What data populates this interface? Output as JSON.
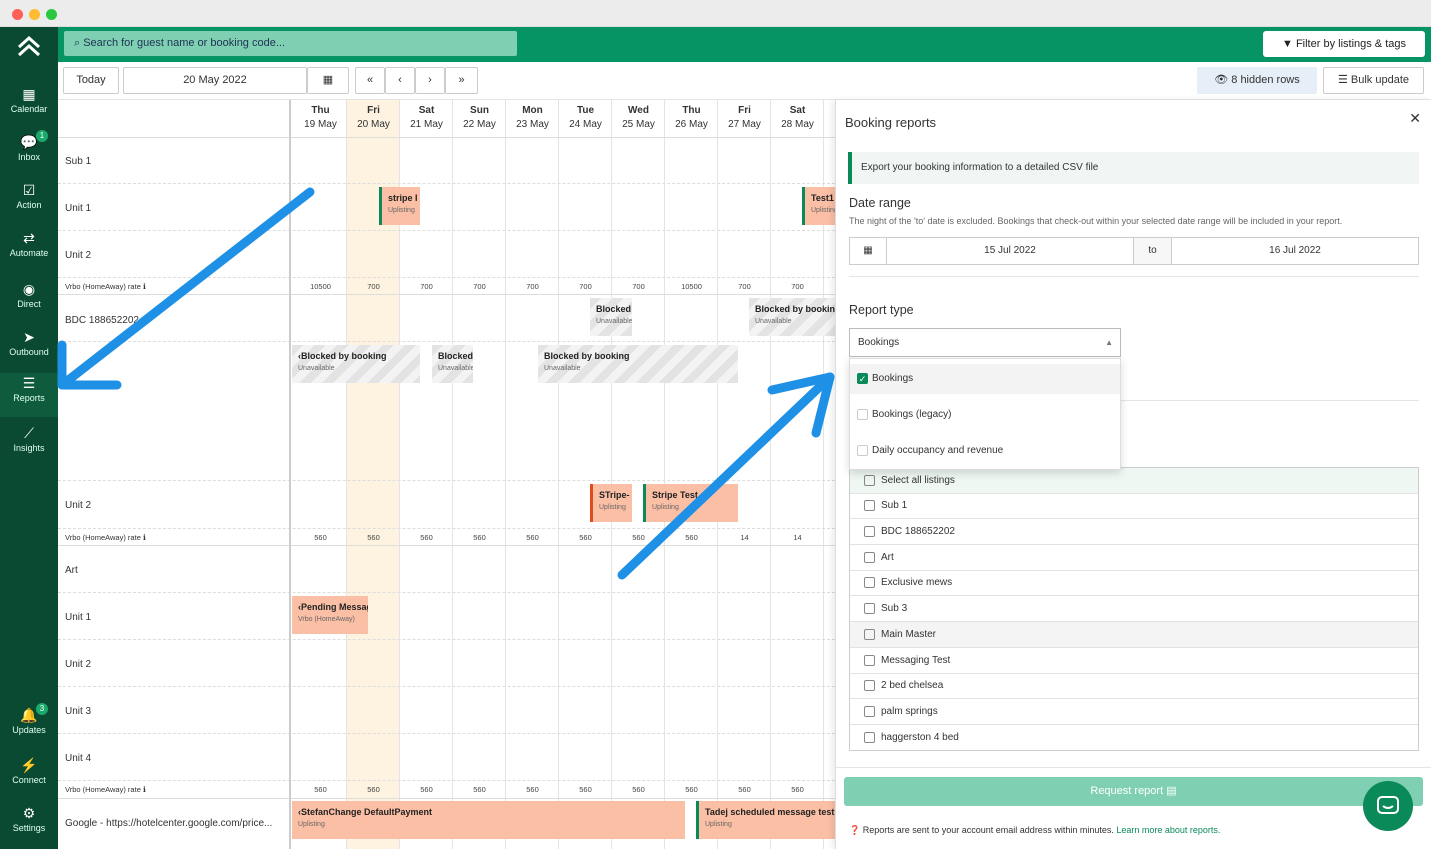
{
  "topbar": {
    "search_placeholder": "Search for guest name or booking code...",
    "filter_label": "Filter by listings & tags"
  },
  "toolbar": {
    "today": "Today",
    "date": "20 May 2022",
    "first": "«",
    "prev": "‹",
    "next": "›",
    "last": "»",
    "hidden_rows": "8 hidden rows",
    "bulk_update": "Bulk update"
  },
  "nav": [
    {
      "label": "Calendar",
      "icon": "calendar-icon"
    },
    {
      "label": "Inbox",
      "icon": "chat-icon",
      "badge": "1"
    },
    {
      "label": "Action",
      "icon": "check-square-icon"
    },
    {
      "label": "Automate",
      "icon": "shuffle-icon"
    },
    {
      "label": "Direct",
      "icon": "direct-icon"
    },
    {
      "label": "Outbound",
      "icon": "send-icon"
    },
    {
      "label": "Reports",
      "icon": "database-icon"
    },
    {
      "label": "Insights",
      "icon": "chart-line-icon"
    },
    {
      "label": "Updates",
      "icon": "bell-icon",
      "badge": "3"
    },
    {
      "label": "Connect",
      "icon": "plug-icon"
    },
    {
      "label": "Settings",
      "icon": "gear-icon"
    }
  ],
  "days": [
    {
      "d": "Thu",
      "n": "19 May"
    },
    {
      "d": "Fri",
      "n": "20 May"
    },
    {
      "d": "Sat",
      "n": "21 May"
    },
    {
      "d": "Sun",
      "n": "22 May"
    },
    {
      "d": "Mon",
      "n": "23 May"
    },
    {
      "d": "Tue",
      "n": "24 May"
    },
    {
      "d": "Wed",
      "n": "25 May"
    },
    {
      "d": "Thu",
      "n": "26 May"
    },
    {
      "d": "Fri",
      "n": "27 May"
    },
    {
      "d": "Sat",
      "n": "28 May"
    }
  ],
  "rows": [
    "Sub 1",
    "Unit 1",
    "Unit 2",
    "Vrbo (HomeAway) rate ℹ",
    "BDC 188652202",
    "Unit 2",
    "Vrbo (HomeAway) rate ℹ",
    "Art",
    "Unit 1",
    "Unit 2",
    "Unit 3",
    "Unit 4",
    "Vrbo (HomeAway) rate ℹ",
    "Google - https://hotelcenter.google.com/price..."
  ],
  "rates": {
    "r1": [
      "10500",
      "700",
      "700",
      "700",
      "700",
      "700",
      "700",
      "10500",
      "700",
      "700"
    ],
    "r2": [
      "560",
      "560",
      "560",
      "560",
      "560",
      "560",
      "560",
      "560",
      "14",
      "14"
    ],
    "r3": [
      "560",
      "560",
      "560",
      "560",
      "560",
      "560",
      "560",
      "560",
      "560",
      "560"
    ]
  },
  "bookings": {
    "stripe1": {
      "title": "stripe I",
      "sub": "Uplisting"
    },
    "test1": {
      "title": "Test1",
      "sub": "Uplisting"
    },
    "blocked1": {
      "title": "Blocked",
      "sub": "Unavailable"
    },
    "blocked2": {
      "title": "Blocked by booking",
      "sub": "Unavailable"
    },
    "blocked3": {
      "title": "‹Blocked by booking",
      "sub": "Unavailable"
    },
    "blocked4": {
      "title": "Blocked",
      "sub": "Unavailable"
    },
    "blocked5": {
      "title": "Blocked by booking",
      "sub": "Unavailable"
    },
    "stripe2": {
      "title": "STripe-",
      "sub": "Uplisting"
    },
    "stripe3": {
      "title": "Stripe Test",
      "sub": "Uplisting"
    },
    "pending": {
      "title": "‹Pending Messag",
      "sub": "Vrbo (HomeAway)"
    },
    "stefan": {
      "title": "‹StefanChange DefaultPayment",
      "sub": "Uplisting"
    },
    "tadej": {
      "title": "Tadej scheduled message test",
      "sub": "Uplisting"
    }
  },
  "panel": {
    "title": "Booking reports",
    "close": "✕",
    "info": "Export your booking information to a detailed CSV file",
    "date_range_label": "Date range",
    "date_range_note": "The night of the 'to' date is excluded. Bookings that check-out within your selected date range will be included in your report.",
    "from": "15 Jul 2022",
    "to_label": "to",
    "to": "16 Jul 2022",
    "report_type_label": "Report type",
    "report_type_value": "Bookings",
    "options": [
      "Bookings",
      "Bookings (legacy)",
      "Daily occupancy and revenue"
    ],
    "listings": [
      "Select all listings",
      "Sub 1",
      "BDC 188652202",
      "Art",
      "Exclusive mews",
      "Sub 3",
      "Main Master",
      "Messaging Test",
      "2 bed chelsea",
      "palm springs",
      "haggerston 4 bed"
    ],
    "request_btn": "Request report",
    "footer_text": "Reports are sent to your account email address within minutes.",
    "footer_link": "Learn more about reports."
  },
  "colors": {
    "brand": "#079464",
    "sidebar": "#0b4a32",
    "booking": "#fbbfa5",
    "annotation": "#1e90e6"
  }
}
